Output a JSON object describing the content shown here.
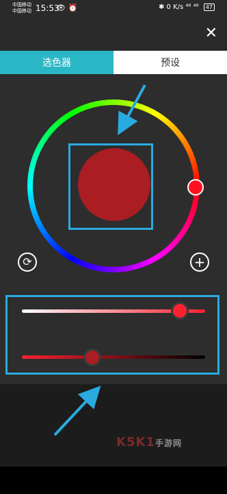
{
  "status_bar": {
    "carrier_1": "中国移动",
    "carrier_2": "中国移动",
    "time": "15:53",
    "icons": "👁 ⏰",
    "right": "✱ 0 K/s ⁴⁶ ⁴⁶",
    "battery": "47"
  },
  "header": {
    "close_icon": "✕"
  },
  "tabs": [
    {
      "label": "选色器",
      "active": true
    },
    {
      "label": "预设",
      "active": false
    }
  ],
  "colors": {
    "accent": "#2bb6c5",
    "selected_color": "#a91d23",
    "highlight_frame": "#29abe2"
  },
  "buttons": {
    "reset_icon": "⟳",
    "add_icon": "+"
  },
  "sliders": {
    "brightness_value": 0.86,
    "saturation_value": 0.39
  },
  "watermark": {
    "brand": "K5K1",
    "site": "手游网"
  }
}
